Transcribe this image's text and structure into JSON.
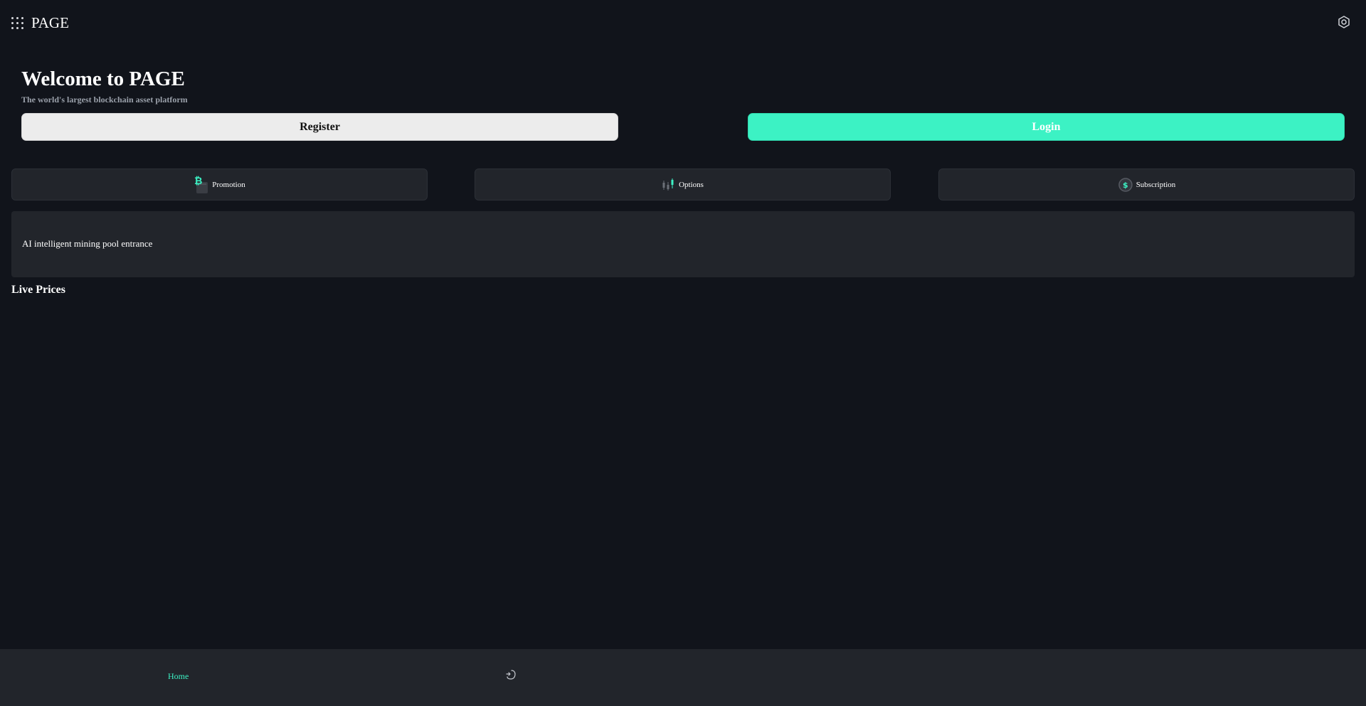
{
  "header": {
    "brand": "PAGE",
    "menu_icon": "grid-menu-icon",
    "settings_icon": "settings-hexagon-icon"
  },
  "hero": {
    "title": "Welcome to PAGE",
    "subtitle": "The world's largest blockchain asset platform",
    "register_label": "Register",
    "login_label": "Login"
  },
  "quick_links": [
    {
      "label": "Promotion",
      "icon": "bitcoin-promotion-icon"
    },
    {
      "label": "Options",
      "icon": "candlestick-options-icon"
    },
    {
      "label": "Subscription",
      "icon": "dollar-subscription-icon"
    }
  ],
  "mining_banner": {
    "label": "AI intelligent mining pool entrance"
  },
  "live_prices": {
    "title": "Live Prices"
  },
  "bottom_nav": {
    "home_label": "Home",
    "second_icon": "trade-icon"
  },
  "colors": {
    "background": "#11141b",
    "card": "#22252b",
    "accent": "#3cf2c4",
    "register_bg": "#ececec"
  }
}
